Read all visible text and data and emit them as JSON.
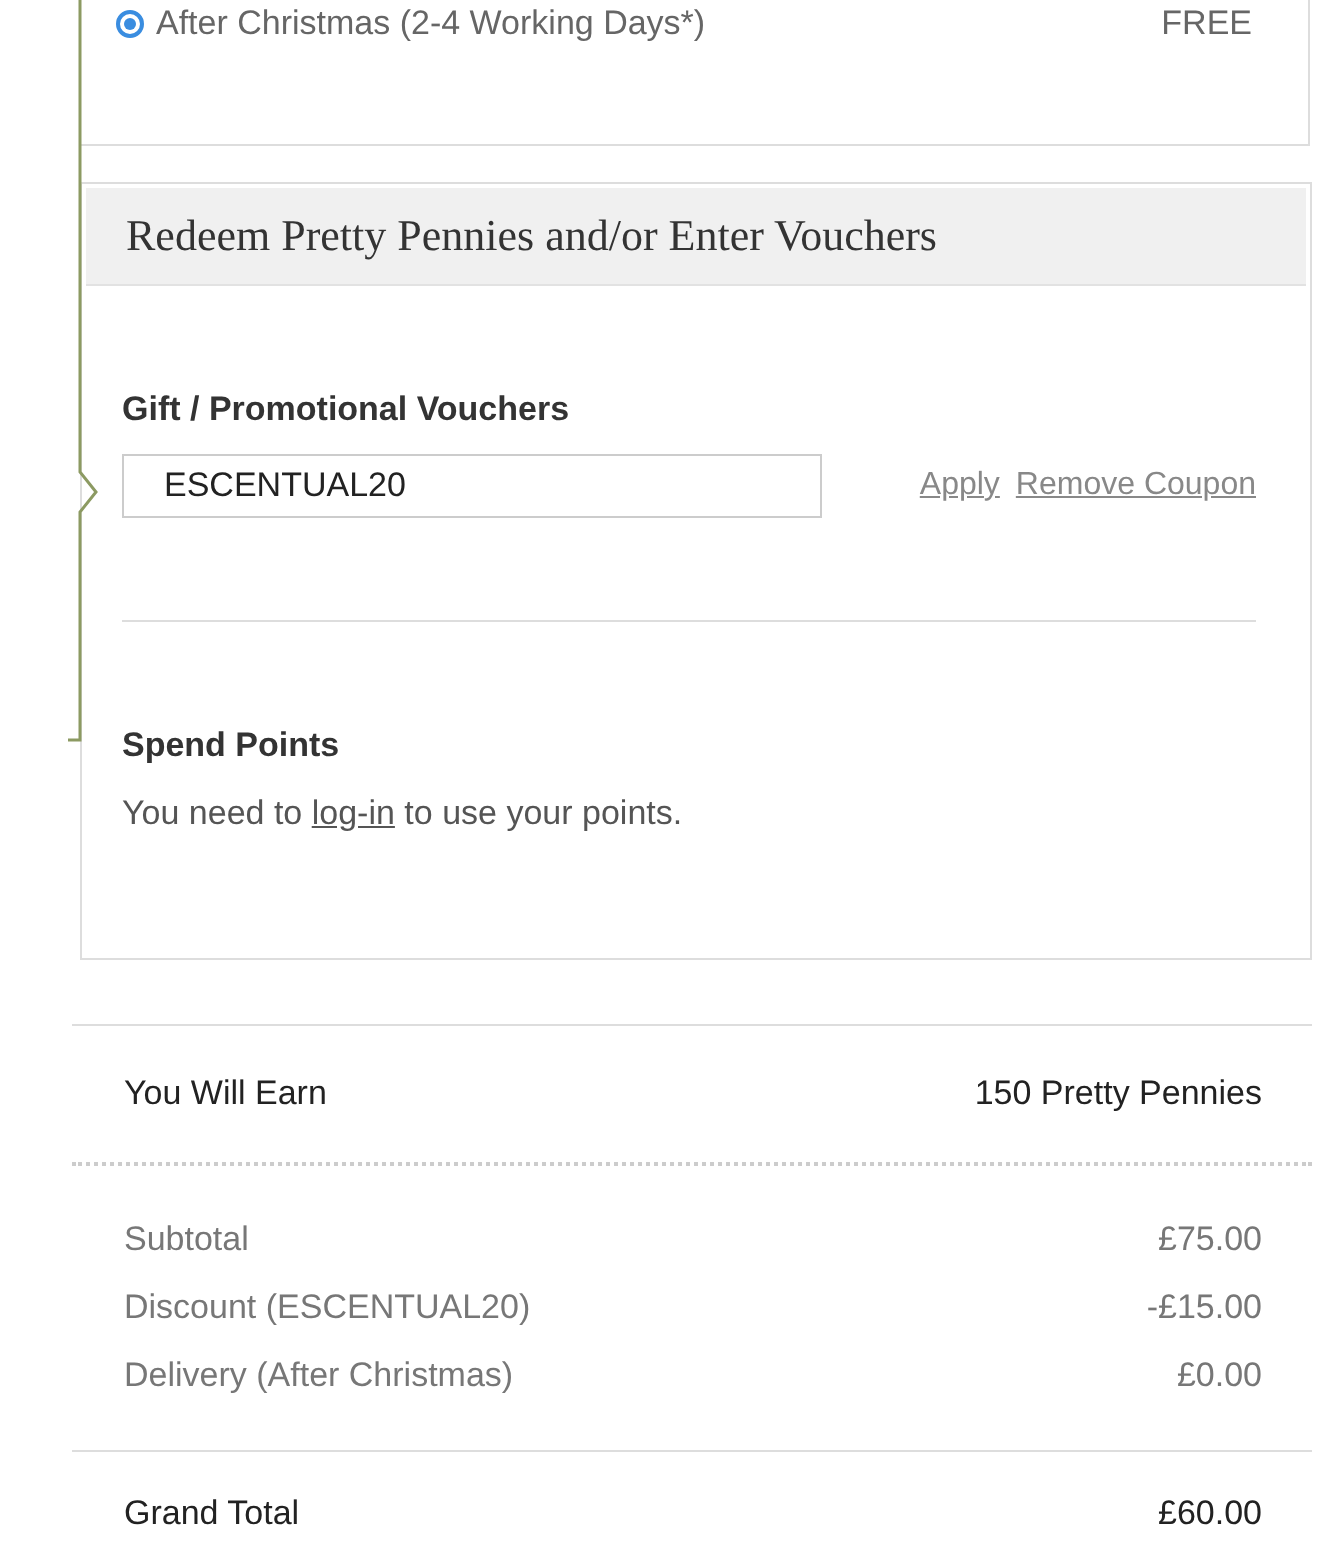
{
  "delivery_option": {
    "label": "After Christmas (2-4 Working Days*)",
    "price": "FREE",
    "selected": true
  },
  "voucher_panel": {
    "title": "Redeem Pretty Pennies and/or Enter Vouchers",
    "voucher_label": "Gift / Promotional Vouchers",
    "voucher_value": "ESCENTUAL20",
    "links": [
      "Apply",
      "Remove Coupon"
    ],
    "points_title": "Spend Points",
    "points_before": "You need to ",
    "points_link": "log-in",
    "points_after": " to use your points."
  },
  "earn": {
    "label": "You Will Earn",
    "value": "150 Pretty Pennies"
  },
  "totals": [
    {
      "label": "Subtotal",
      "value": "£75.00"
    },
    {
      "label": "Discount (ESCENTUAL20)",
      "value": "-£15.00"
    },
    {
      "label": "Delivery (After Christmas)",
      "value": "£0.00"
    }
  ],
  "grand_total": {
    "label": "Grand Total",
    "value": "£60.00"
  }
}
